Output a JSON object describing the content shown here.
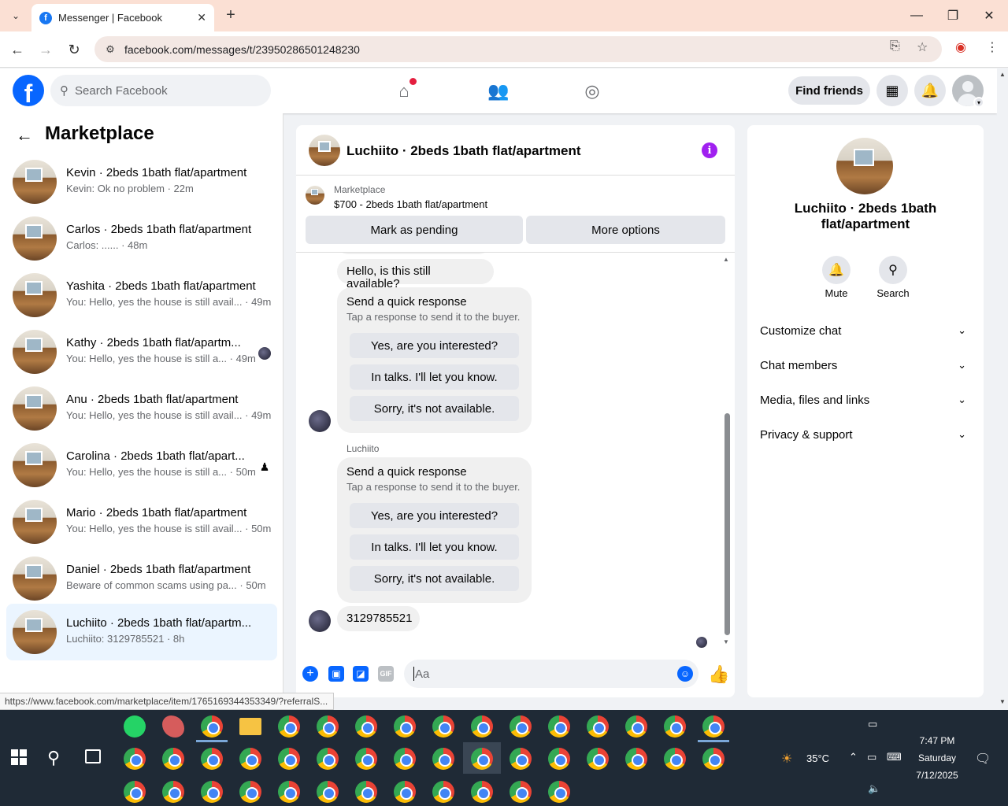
{
  "browser": {
    "tab_title": "Messenger | Facebook",
    "url": "facebook.com/messages/t/23950286501248230",
    "status_url": "https://www.facebook.com/marketplace/item/1765169344353349/?referralS..."
  },
  "header": {
    "search_placeholder": "Search Facebook",
    "find_friends": "Find friends"
  },
  "sidebar": {
    "title": "Marketplace",
    "conversations": [
      {
        "name": "Kevin · 2beds 1bath flat/apartment",
        "preview": "Kevin: Ok no problem · 22m"
      },
      {
        "name": "Carlos · 2beds 1bath flat/apartment",
        "preview": "Carlos: ...... · 48m"
      },
      {
        "name": "Yashita · 2beds 1bath flat/apartment",
        "preview": "You: Hello, yes the house is still avail... · 49m"
      },
      {
        "name": "Kathy · 2beds 1bath flat/apartm...",
        "preview": "You: Hello, yes the house is still a... · 49m"
      },
      {
        "name": "Anu · 2beds 1bath flat/apartment",
        "preview": "You: Hello, yes the house is still avail... · 49m"
      },
      {
        "name": "Carolina · 2beds 1bath flat/apart...",
        "preview": "You: Hello, yes the house is still a... · 50m"
      },
      {
        "name": "Mario · 2beds 1bath flat/apartment",
        "preview": "You: Hello, yes the house is still avail... · 50m"
      },
      {
        "name": "Daniel · 2beds 1bath flat/apartment",
        "preview": "Beware of common scams using pa... · 50m"
      },
      {
        "name": "Luchiito · 2beds 1bath flat/apartm...",
        "preview": "Luchiito: 3129785521 · 8h"
      }
    ]
  },
  "chat": {
    "title": "Luchiito · 2beds 1bath flat/apartment",
    "listing_source": "Marketplace",
    "listing_desc": "$700 - 2beds 1bath flat/apartment",
    "mark_pending": "Mark as pending",
    "more_options": "More options",
    "msg_hello": "Hello, is this still available?",
    "qr_title": "Send a quick response",
    "qr_sub": "Tap a response to send it to the buyer.",
    "qr_opt1": "Yes, are you interested?",
    "qr_opt2": "In talks. I'll let you know.",
    "qr_opt3": "Sorry, it's not available.",
    "sender": "Luchiito",
    "msg_phone": "3129785521",
    "composer_placeholder": "Aa"
  },
  "details": {
    "name": "Luchiito · 2beds 1bath flat/apartment",
    "mute": "Mute",
    "search": "Search",
    "rows": [
      "Customize chat",
      "Chat members",
      "Media, files and links",
      "Privacy & support"
    ]
  },
  "taskbar": {
    "temperature": "35°C",
    "time": "7:47 PM",
    "day": "Saturday",
    "date": "7/12/2025"
  },
  "colors": {
    "fb_blue": "#0866ff",
    "info_purple": "#a020f0",
    "active_conv": "#ebf5ff",
    "tab_strip": "#fbe0d4"
  }
}
